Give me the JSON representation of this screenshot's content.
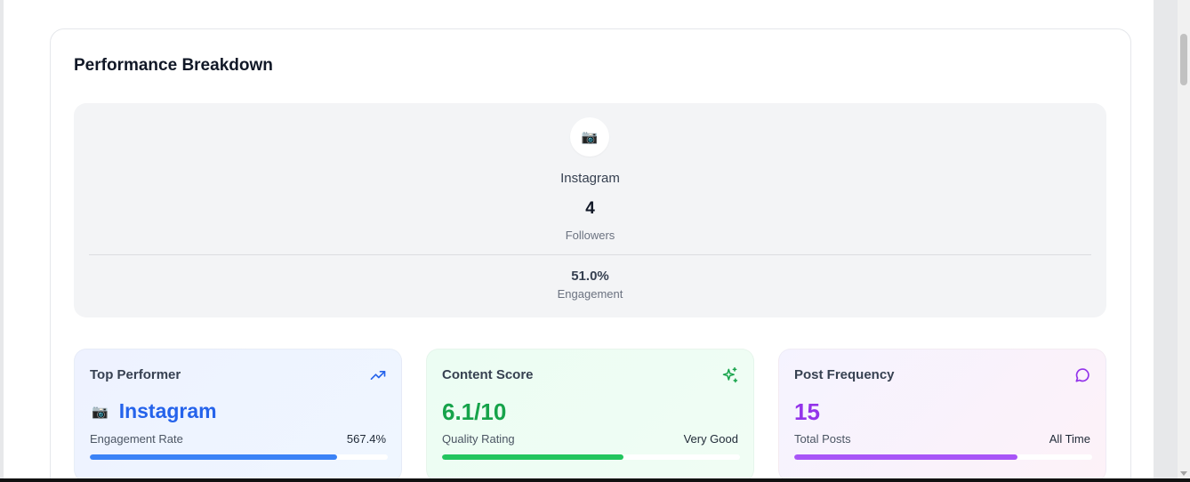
{
  "card": {
    "title": "Performance Breakdown"
  },
  "platform": {
    "icon": "camera-icon",
    "icon_glyph": "📷",
    "name": "Instagram",
    "followers_value": "4",
    "followers_label": "Followers",
    "engagement_value": "51.0%",
    "engagement_label": "Engagement"
  },
  "stats": {
    "top_performer": {
      "title": "Top Performer",
      "icon": "trending-up-icon",
      "emoji": "📷",
      "value": "Instagram",
      "sub_label": "Engagement Rate",
      "sub_value": "567.4%",
      "progress": 0.83,
      "color": "#3b82f6"
    },
    "content_score": {
      "title": "Content Score",
      "icon": "sparkles-icon",
      "value": "6.1/10",
      "sub_label": "Quality Rating",
      "sub_value": "Very Good",
      "progress": 0.61,
      "color": "#22c55e"
    },
    "post_frequency": {
      "title": "Post Frequency",
      "icon": "message-circle-icon",
      "value": "15",
      "sub_label": "Total Posts",
      "sub_value": "All Time",
      "progress": 0.75,
      "color": "#a855f7"
    }
  }
}
